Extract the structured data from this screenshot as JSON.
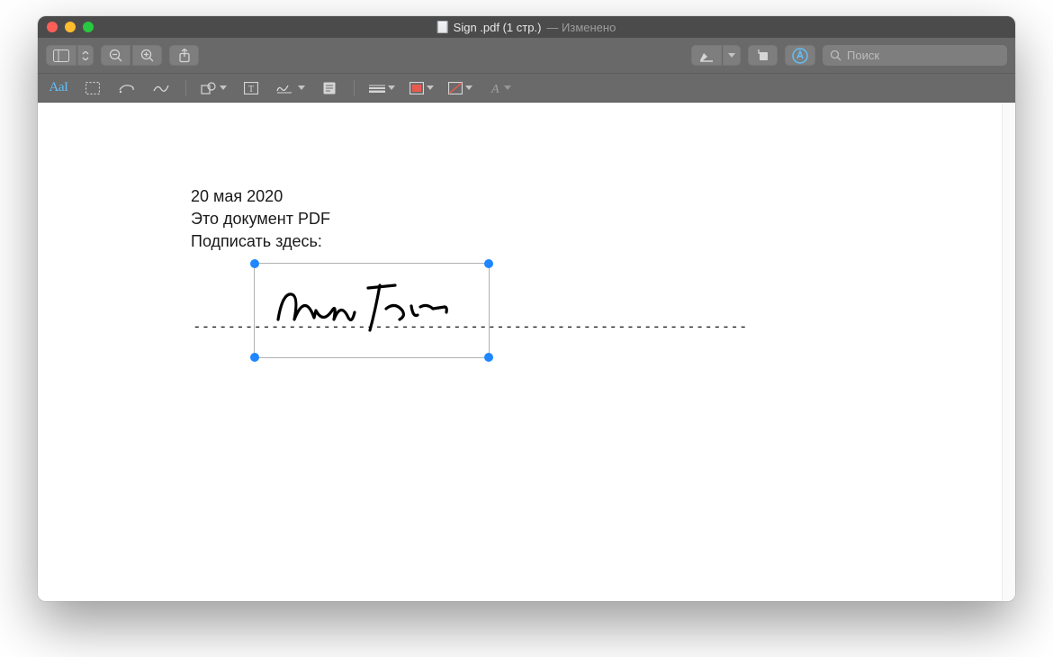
{
  "window": {
    "title_main": "Sign .pdf (1 стр.)",
    "title_sub": "— Изменено"
  },
  "toolbar": {
    "search_placeholder": "Поиск"
  },
  "markup": {
    "text_style_label": "AaI"
  },
  "document": {
    "date": "20 мая 2020",
    "line2": "Это документ PDF",
    "line3": "Подписать здесь:",
    "dashes": "----------------------------------------------------------------"
  }
}
